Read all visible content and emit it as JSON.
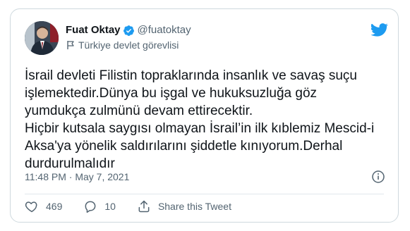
{
  "user": {
    "name": "Fuat Oktay",
    "handle": "@fuatoktay",
    "label": "Türkiye devlet görevlisi"
  },
  "tweet": {
    "lines": [
      "İsrail devleti Filistin topraklarında insanlık ve savaş suçu",
      "işlemektedir.Dünya bu işgal ve hukuksuzluğa göz",
      "yumdukça zulmünü devam ettirecektir.",
      "Hiçbir kutsala saygısı olmayan İsrail’in ilk kıblemiz Mescid-i",
      "Aksa'ya yönelik saldırılarını şiddetle kınıyorum.Derhal",
      "durdurulmalıdır"
    ],
    "timestamp": "11:48 PM · May 7, 2021"
  },
  "actions": {
    "likes": "469",
    "replies": "10",
    "share_label": "Share this Tweet"
  },
  "icons": {
    "verified": "verified-badge-icon",
    "label": "flag-icon",
    "brand": "twitter-bird-icon",
    "info": "info-icon",
    "like": "heart-icon",
    "reply": "reply-icon",
    "share": "share-icon"
  },
  "colors": {
    "brand_blue": "#1d9bf0",
    "text": "#0f1419",
    "secondary": "#536471",
    "border": "#cfd9de"
  }
}
